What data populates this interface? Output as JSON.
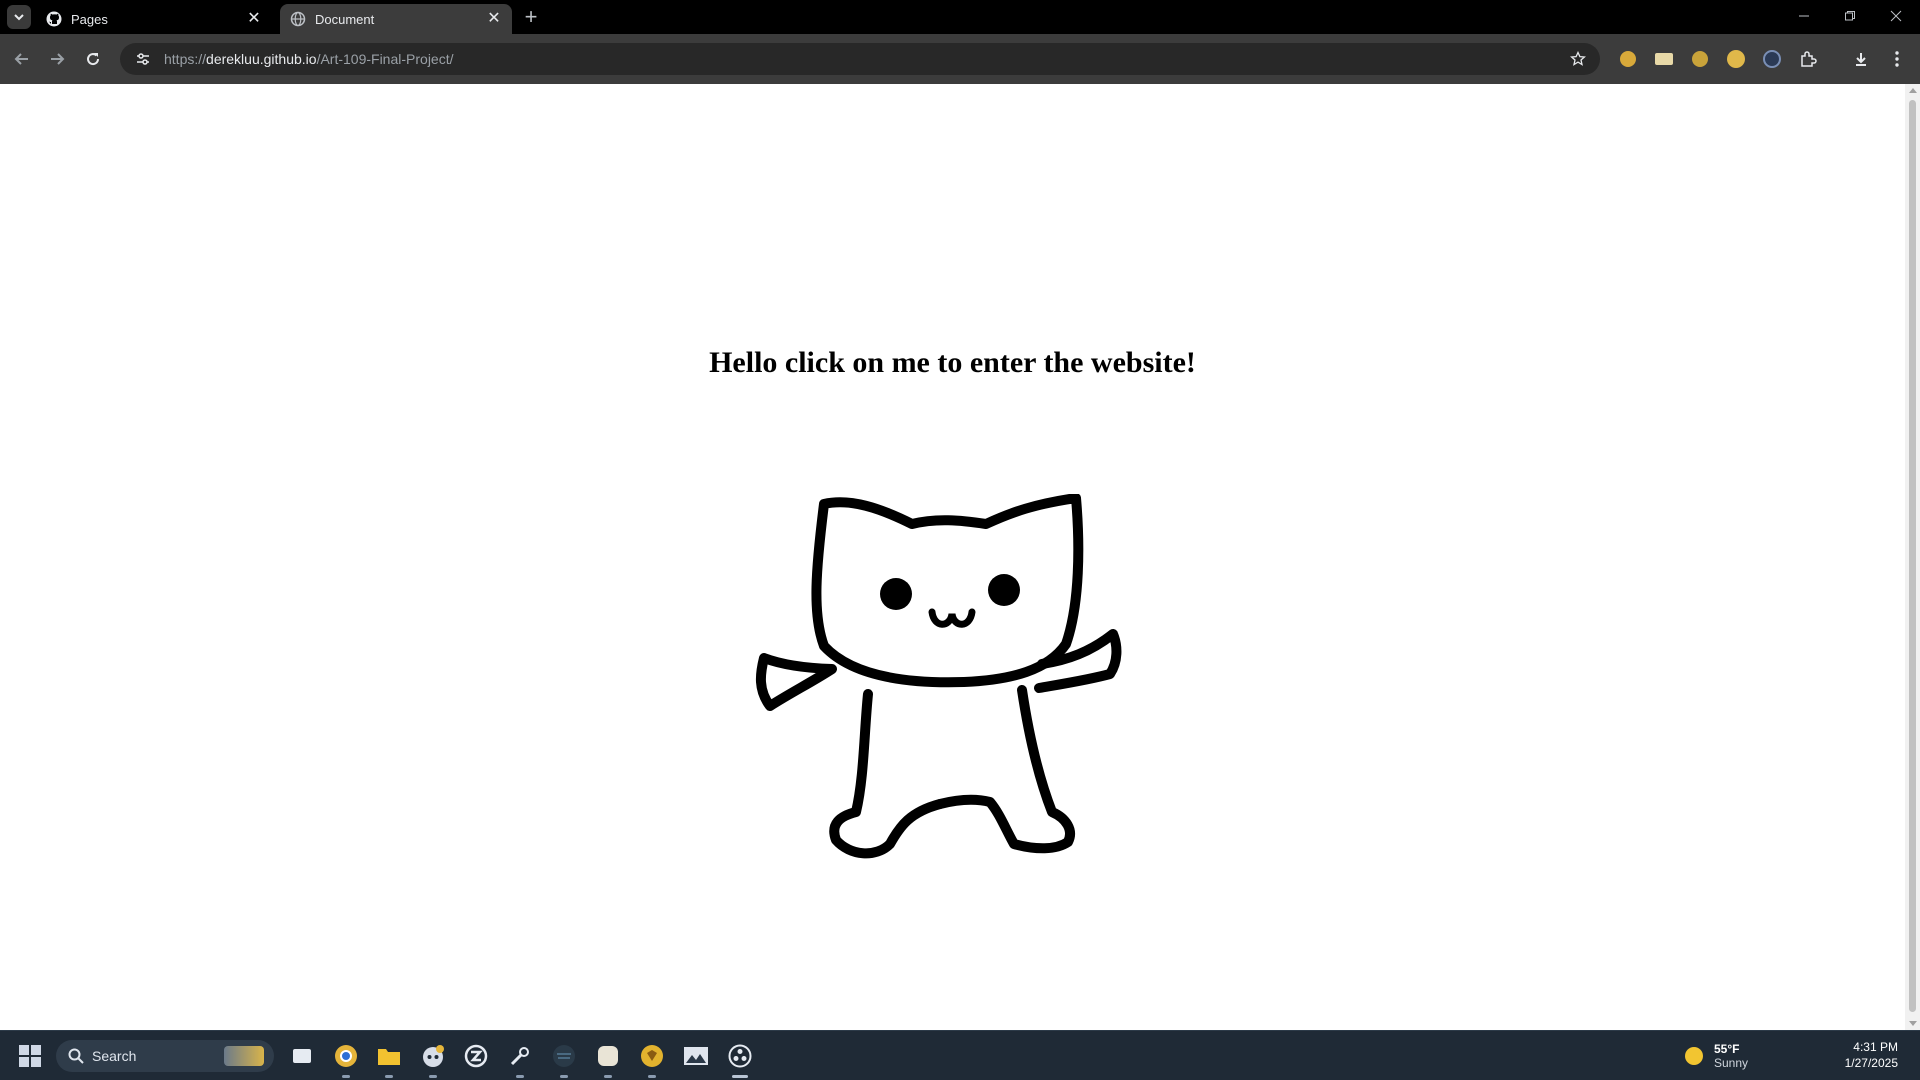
{
  "browser": {
    "tabs": [
      {
        "title": "Pages",
        "favicon": "github-icon",
        "active": false
      },
      {
        "title": "Document",
        "favicon": "globe-icon",
        "active": true
      }
    ],
    "new_tab_label": "+",
    "address": {
      "scheme": "https://",
      "host": "derekluu.github.io",
      "path": "/Art-109-Final-Project/"
    },
    "extensions": [
      "extension-icon-1",
      "extension-icon-2",
      "extension-icon-3",
      "extension-icon-4",
      "extension-icon-5",
      "puzzle-icon"
    ]
  },
  "page": {
    "heading": "Hello click on me to enter the website!",
    "image": "cat-drawing"
  },
  "taskbar": {
    "search_label": "Search",
    "apps": [
      "task-view-icon",
      "chrome-icon",
      "file-explorer-icon",
      "discord-icon",
      "lol-client-icon",
      "steam-icon",
      "app-icon-1",
      "app-icon-2",
      "app-icon-3",
      "photos-icon",
      "obs-icon"
    ],
    "weather": {
      "temp": "55°F",
      "condition": "Sunny"
    },
    "clock": {
      "time": "4:31 PM",
      "date": "1/27/2025"
    }
  },
  "colors": {
    "tabstrip_bg": "#000000",
    "toolbar_bg": "#3c3c3c",
    "omnibox_bg": "#282828",
    "page_bg": "#ffffff",
    "taskbar_bg": "#1f2a36"
  }
}
